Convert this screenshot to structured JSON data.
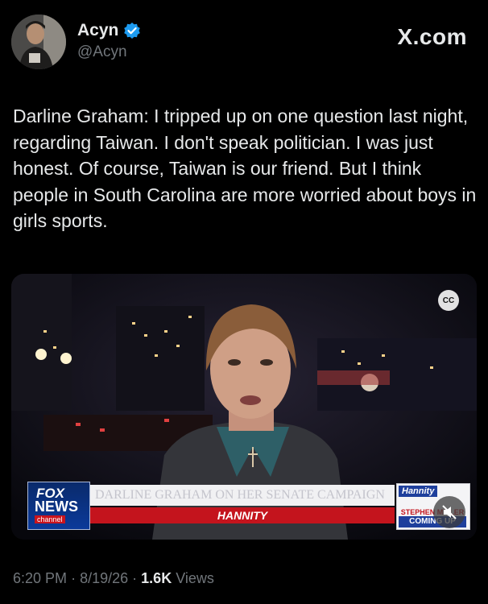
{
  "author": {
    "display_name": "Acyn",
    "handle": "@Acyn",
    "verified_icon": "verified-badge-icon"
  },
  "source": "X.com",
  "tweet_text": "Darline Graham: I tripped up on one question last night, regarding Taiwan. I don't speak politician. I was just honest. Of course, Taiwan is our friend. But I think people in South Carolina are more worried about boys in girls sports.",
  "media": {
    "cc_label": "CC",
    "network_logo": {
      "line1": "FOX",
      "line2": "NEWS",
      "line3": "channel"
    },
    "chyron_headline": "DARLINE GRAHAM ON HER SENATE CAMPAIGN",
    "chyron_show": "HANNITY",
    "promo": {
      "show": "Hannity",
      "guest": "STEPHEN MILLER",
      "cta": "COMING UP"
    },
    "mute_icon": "mute-icon"
  },
  "meta": {
    "time": "6:20 PM",
    "separator": "·",
    "date": "8/19/26",
    "views_count": "1.6K",
    "views_label": "Views"
  },
  "colors": {
    "background": "#000000",
    "text": "#e7e9ea",
    "muted": "#71767b",
    "verified": "#1d9bf0"
  }
}
